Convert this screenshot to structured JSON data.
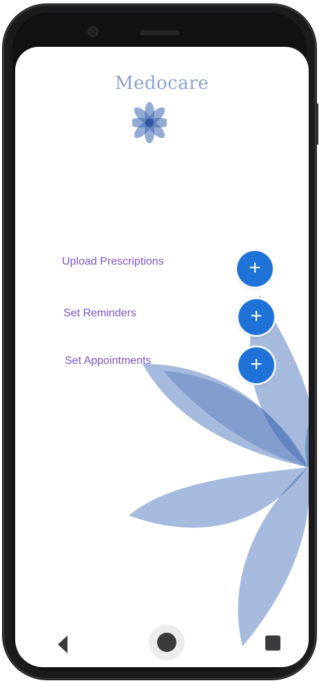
{
  "app": {
    "title": "Medocare"
  },
  "actions": [
    {
      "label": "Upload Prescriptions",
      "icon": "plus-icon"
    },
    {
      "label": "Set Reminders",
      "icon": "plus-icon"
    },
    {
      "label": "Set Appointments",
      "icon": "plus-icon"
    }
  ],
  "action_symbol": "+",
  "colors": {
    "title": "#8ba3d1",
    "label": "#7a52c7",
    "button": "#1f73d8",
    "flower": "#3a66b3"
  },
  "nav": {
    "back_icon": "triangle-back-icon",
    "home_icon": "circle-home-icon",
    "recents_icon": "square-recents-icon"
  }
}
